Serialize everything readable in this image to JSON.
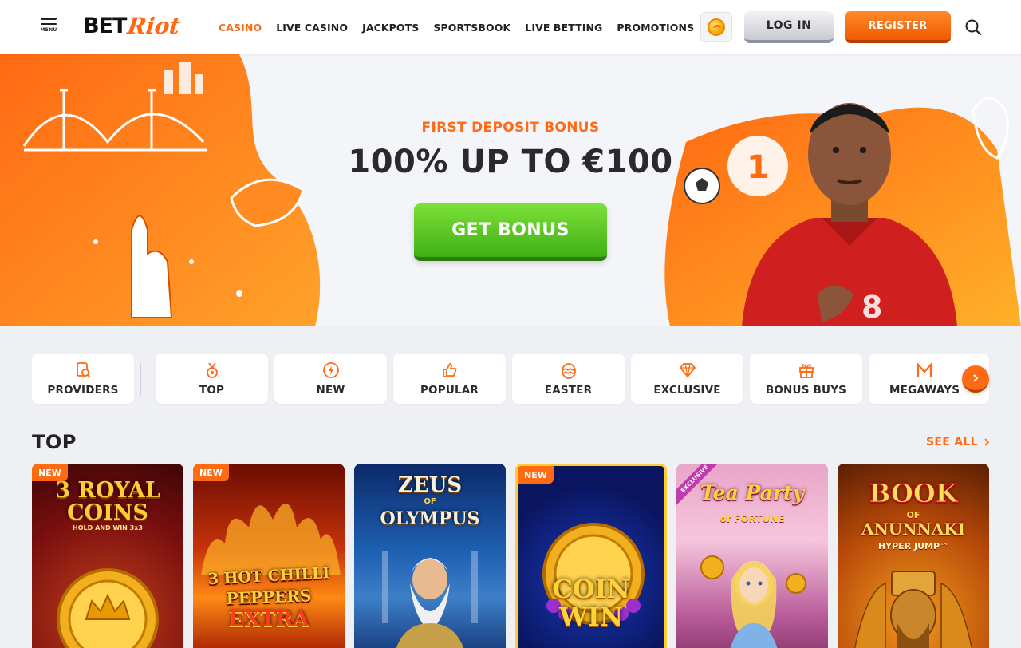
{
  "header": {
    "menu_label": "MENU",
    "logo_bet": "BET",
    "logo_riot": "Riot",
    "nav": [
      {
        "label": "CASINO",
        "active": true
      },
      {
        "label": "LIVE CASINO",
        "active": false
      },
      {
        "label": "JACKPOTS",
        "active": false
      },
      {
        "label": "SPORTSBOOK",
        "active": false
      },
      {
        "label": "LIVE BETTING",
        "active": false
      },
      {
        "label": "PROMOTIONS",
        "active": false
      }
    ],
    "login_label": "LOG IN",
    "register_label": "REGISTER"
  },
  "hero": {
    "subtitle": "FIRST DEPOSIT BONUS",
    "title": "100% UP TO €100",
    "cta_label": "GET BONUS"
  },
  "categories": [
    {
      "label": "PROVIDERS",
      "icon": "providers-icon"
    },
    {
      "label": "TOP",
      "icon": "medal-icon"
    },
    {
      "label": "NEW",
      "icon": "lightning-icon"
    },
    {
      "label": "POPULAR",
      "icon": "thumbs-up-icon"
    },
    {
      "label": "EASTER",
      "icon": "egg-icon"
    },
    {
      "label": "EXCLUSIVE",
      "icon": "diamond-icon"
    },
    {
      "label": "BONUS BUYS",
      "icon": "gift-icon"
    },
    {
      "label": "MEGAWAYS",
      "icon": "megaways-icon"
    }
  ],
  "section": {
    "title": "TOP",
    "see_all_label": "SEE ALL"
  },
  "games": [
    {
      "title_line1": "3 ROYAL",
      "title_line2": "COINS",
      "subtitle": "HOLD AND WIN 3x3",
      "badge": "NEW"
    },
    {
      "title_line1": "3 HOT CHILLI",
      "title_line2": "PEPPERS",
      "subtitle": "EXTRA",
      "badge": "NEW"
    },
    {
      "title_line1": "ZEUS",
      "title_line2": "OLYMPUS",
      "subtitle": "OF",
      "badge": ""
    },
    {
      "title_line1": "COIN",
      "title_line2": "WIN",
      "subtitle": "",
      "badge": "NEW"
    },
    {
      "title_line1": "Tea Party",
      "title_line2": "",
      "subtitle": "of FORTUNE",
      "badge": "EXCLUSIVE"
    },
    {
      "title_line1": "BOOK",
      "title_line2": "ANUNNAKI",
      "subtitle": "OF",
      "subtitle2": "HYPER JUMP™",
      "badge": ""
    }
  ],
  "colors": {
    "accent": "#ff6a13",
    "cta_green": "#3fb014",
    "text_dark": "#2a2a2a"
  }
}
